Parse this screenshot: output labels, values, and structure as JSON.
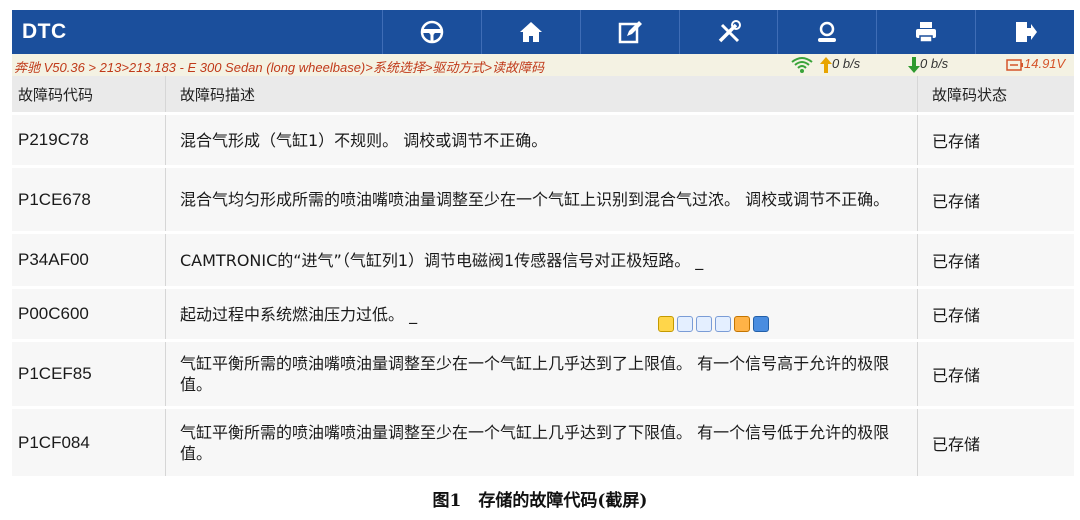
{
  "toolbar": {
    "title": "DTC",
    "icons": [
      "steering-wheel-icon",
      "home-icon",
      "edit-icon",
      "tools-icon",
      "user-icon",
      "printer-icon",
      "exit-icon"
    ],
    "color": "#1b4f9c"
  },
  "status": {
    "breadcrumb": "奔驰 V50.36 > 213>213.183 - E 300 Sedan (long wheelbase)>系统选择>驱动方式>读故障码",
    "upload_speed": "0 b/s",
    "download_speed": "0 b/s",
    "battery_voltage": "14.91V"
  },
  "table": {
    "headers": {
      "code": "故障码代码",
      "description": "故障码描述",
      "status": "故障码状态"
    },
    "rows": [
      {
        "code": "P219C78",
        "description": "混合气形成（气缸1）不规则。 调校或调节不正确。",
        "status": "已存储"
      },
      {
        "code": "P1CE678",
        "description": "混合气均匀形成所需的喷油嘴喷油量调整至少在一个气缸上识别到混合气过浓。 调校或调节不正确。",
        "status": "已存储"
      },
      {
        "code": "P34AF00",
        "description": "CAMTRONIC的“进气”（气缸列1）调节电磁阀1传感器信号对正极短路。 _",
        "status": "已存储"
      },
      {
        "code": "P00C600",
        "description": "起动过程中系统燃油压力过低。 _",
        "status": "已存储"
      },
      {
        "code": "P1CEF85",
        "description": "气缸平衡所需的喷油嘴喷油量调整至少在一个气缸上几乎达到了上限值。 有一个信号高于允许的极限值。",
        "status": "已存储"
      },
      {
        "code": "P1CF084",
        "description": "气缸平衡所需的喷油嘴喷油量调整至少在一个气缸上几乎达到了下限值。 有一个信号低于允许的极限值。",
        "status": "已存储"
      }
    ]
  },
  "caption": "图1　存储的故障代码(截屏)"
}
